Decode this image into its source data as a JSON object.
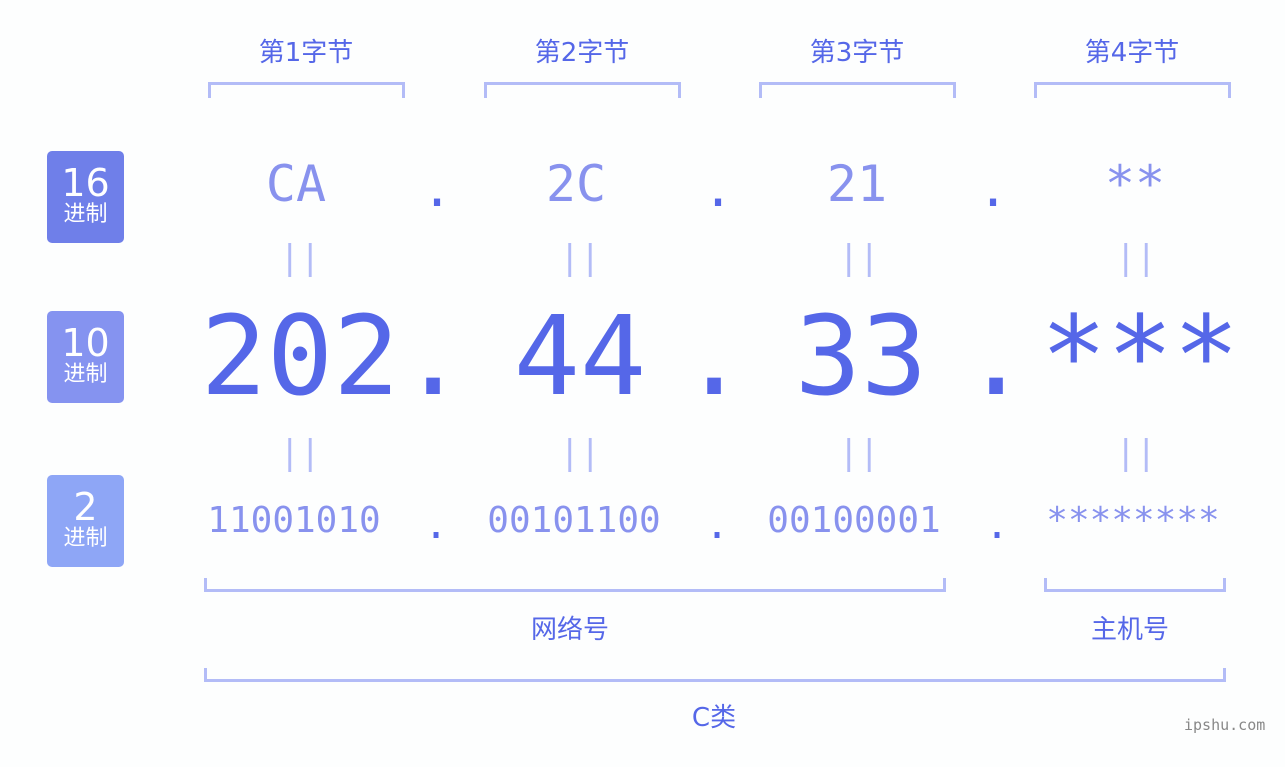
{
  "bytes": [
    {
      "label": "第1字节",
      "hex": "CA",
      "dec": "202",
      "bin": "11001010"
    },
    {
      "label": "第2字节",
      "hex": "2C",
      "dec": "44",
      "bin": "00101100"
    },
    {
      "label": "第3字节",
      "hex": "21",
      "dec": "33",
      "bin": "00100001"
    },
    {
      "label": "第4字节",
      "hex": "**",
      "dec": "***",
      "bin": "********"
    }
  ],
  "separator": ".",
  "equals": "||",
  "rows": {
    "hex": {
      "num": "16",
      "sub": "进制",
      "color": "#6f7fe9"
    },
    "dec": {
      "num": "10",
      "sub": "进制",
      "color": "#8593f0"
    },
    "bin": {
      "num": "2",
      "sub": "进制",
      "color": "#8ea6f6"
    }
  },
  "parts": {
    "network": "网络号",
    "host": "主机号",
    "class": "C类"
  },
  "watermark": "ipshu.com"
}
